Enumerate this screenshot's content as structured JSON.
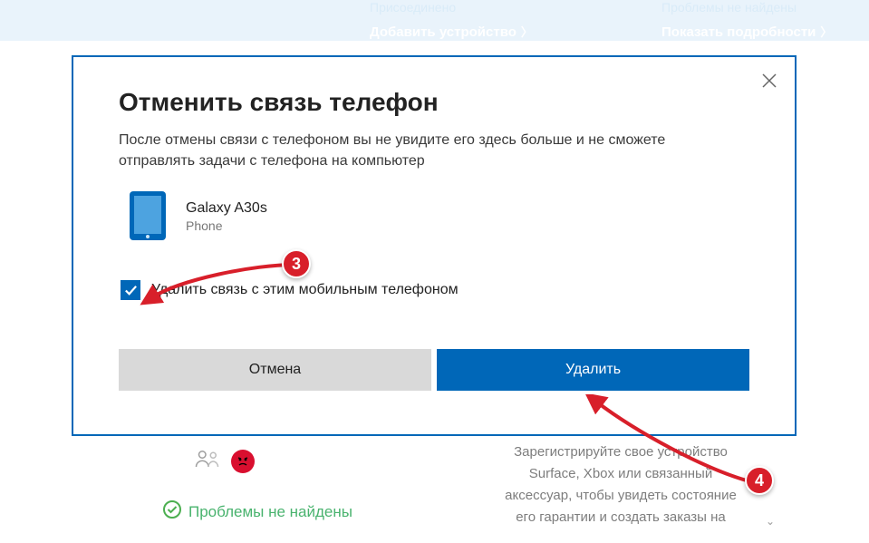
{
  "top": {
    "faded1": "Присоединено",
    "link1": "Добавить устройство",
    "faded2": "Проблемы не найдены",
    "link2": "Показать подробности"
  },
  "dialog": {
    "title": "Отменить связь телефон",
    "body": "После отмены связи с телефоном вы не увидите его здесь больше и не сможете отправлять задачи с телефона на компьютер",
    "device": {
      "name": "Galaxy A30s",
      "type": "Phone"
    },
    "checkbox_label": "Удалить связь с этим мобильным телефоном",
    "cancel": "Отмена",
    "delete": "Удалить"
  },
  "bg": {
    "ok_text": "Проблемы не найдены",
    "card2_l1": "Зарегистрируйте свое устройство",
    "card2_l2": "Surface, Xbox или связанный",
    "card2_l3": "аксессуар, чтобы увидеть состояние",
    "card2_l4": "его гарантии и создать заказы на"
  },
  "markers": {
    "m3": "3",
    "m4": "4"
  },
  "colors": {
    "accent": "#0067b8",
    "danger": "#d81f2a"
  }
}
